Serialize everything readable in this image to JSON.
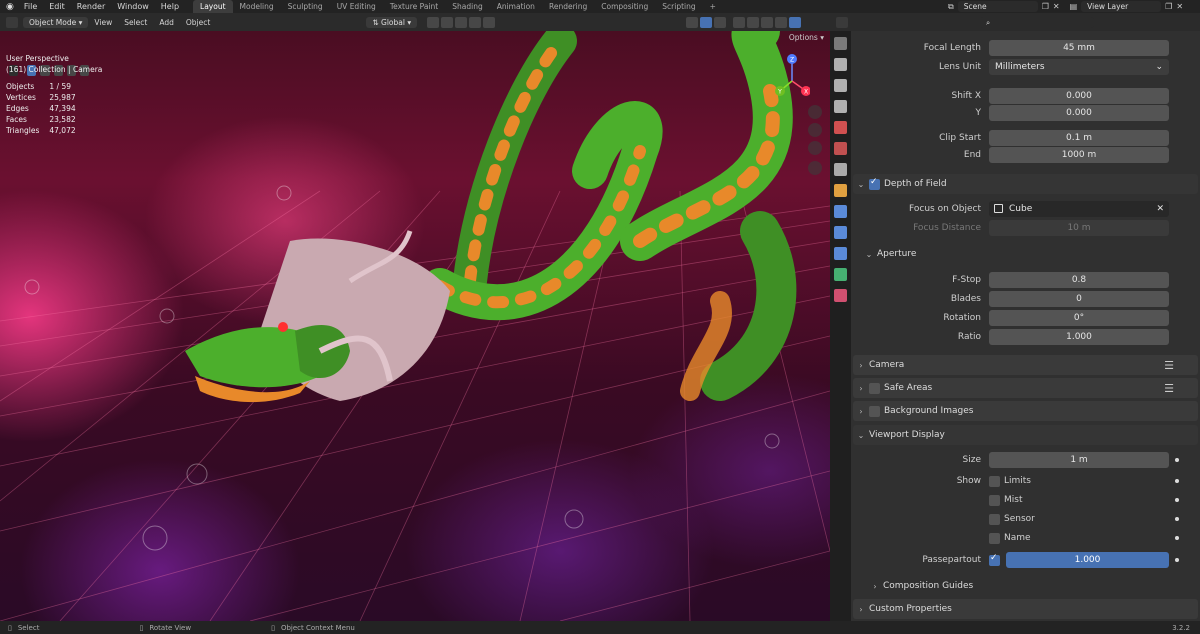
{
  "topbar": {
    "menu": [
      "File",
      "Edit",
      "Render",
      "Window",
      "Help"
    ],
    "workspaces": [
      "Layout",
      "Modeling",
      "Sculpting",
      "UV Editing",
      "Texture Paint",
      "Shading",
      "Animation",
      "Rendering",
      "Compositing",
      "Scripting"
    ],
    "active_workspace": "Layout",
    "add_tab": "+",
    "scene": "Scene",
    "view_layer": "View Layer"
  },
  "viewport_header": {
    "mode": "Object Mode",
    "menus": [
      "View",
      "Select",
      "Add",
      "Object"
    ],
    "transform_orientation": "Global",
    "options": "Options"
  },
  "viewport": {
    "view_name": "User Perspective",
    "collection": "(161) Collection | Camera",
    "stats": [
      {
        "label": "Objects",
        "value": "1 / 59"
      },
      {
        "label": "Vertices",
        "value": "25,987"
      },
      {
        "label": "Edges",
        "value": "47,394"
      },
      {
        "label": "Faces",
        "value": "23,582"
      },
      {
        "label": "Triangles",
        "value": "47,072"
      }
    ],
    "gizmo": {
      "x": "X",
      "y": "Y",
      "z": "Z"
    }
  },
  "properties": {
    "search_placeholder": "",
    "focal_length_label": "Focal Length",
    "focal_length": "45 mm",
    "lens_unit_label": "Lens Unit",
    "lens_unit": "Millimeters",
    "shift_x_label": "Shift X",
    "shift_x": "0.000",
    "shift_y_label": "Y",
    "shift_y": "0.000",
    "clip_start_label": "Clip Start",
    "clip_start": "0.1 m",
    "clip_end_label": "End",
    "clip_end": "1000 m",
    "dof": {
      "title": "Depth of Field",
      "enabled": true,
      "focus_object_label": "Focus on Object",
      "focus_object": "Cube",
      "focus_distance_label": "Focus Distance",
      "focus_distance": "10 m",
      "aperture_title": "Aperture",
      "fstop_label": "F-Stop",
      "fstop": "0.8",
      "blades_label": "Blades",
      "blades": "0",
      "rotation_label": "Rotation",
      "rotation": "0°",
      "ratio_label": "Ratio",
      "ratio": "1.000"
    },
    "camera_title": "Camera",
    "safe_areas_title": "Safe Areas",
    "background_images_title": "Background Images",
    "viewport_display": {
      "title": "Viewport Display",
      "size_label": "Size",
      "size": "1 m",
      "show_label": "Show",
      "limits": "Limits",
      "mist": "Mist",
      "sensor": "Sensor",
      "name": "Name",
      "passepartout_label": "Passepartout",
      "passepartout": "1.000"
    },
    "composition_guides_title": "Composition Guides",
    "custom_properties_title": "Custom Properties"
  },
  "statusbar": {
    "select": "Select",
    "rotate": "Rotate View",
    "context": "Object Context Menu",
    "version": "3.2.2"
  },
  "colors": {
    "accent": "#4772b3",
    "panel": "#303030",
    "dragon_green": "#4caf2c",
    "dragon_orange": "#e8892a"
  }
}
